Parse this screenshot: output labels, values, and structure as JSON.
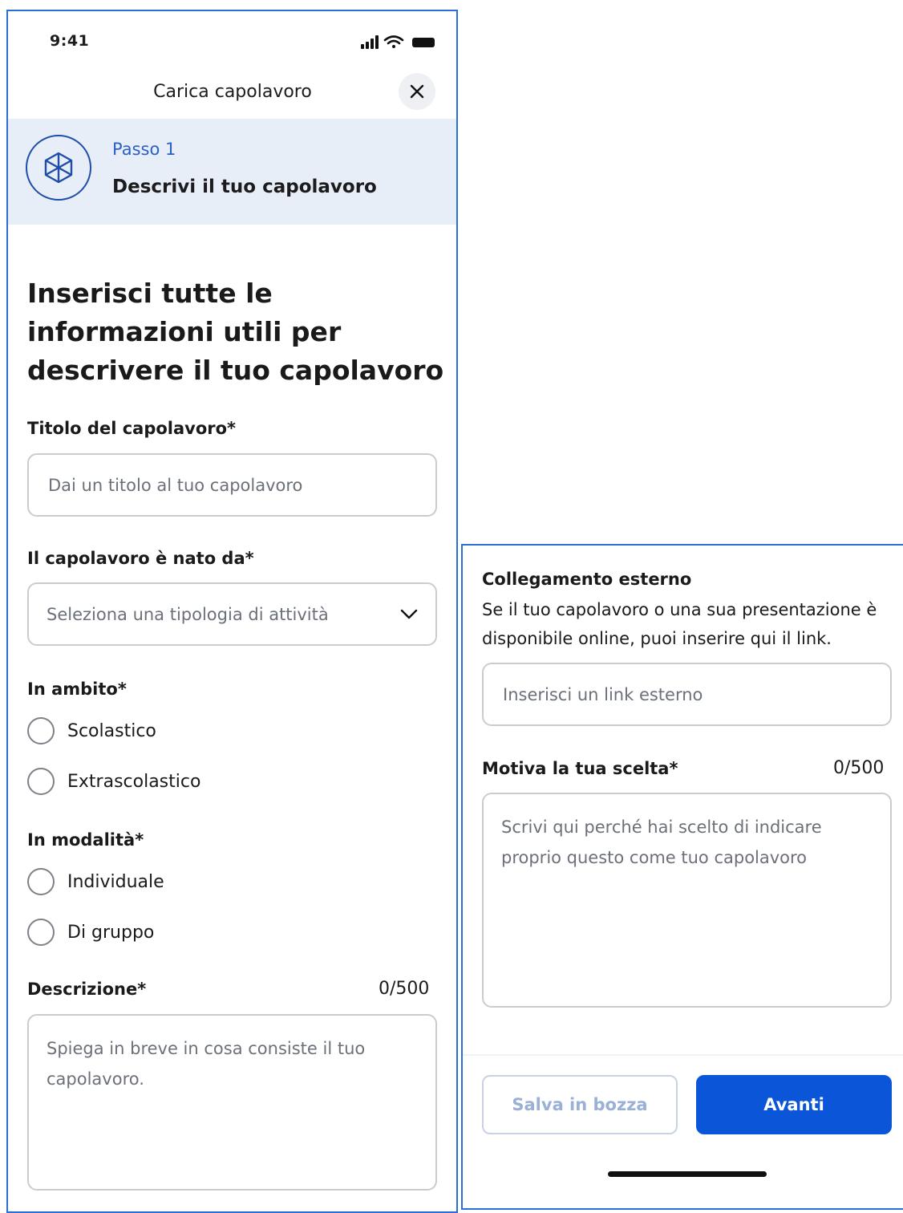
{
  "status_bar": {
    "time": "9:41"
  },
  "header": {
    "title": "Carica capolavoro",
    "close_icon": "close-icon"
  },
  "step": {
    "label": "Passo 1",
    "title": "Descrivi il tuo capolavoro",
    "icon": "cube-icon"
  },
  "form": {
    "heading": "Inserisci tutte le informazioni utili per descrivere il tuo capolavoro",
    "title_field": {
      "label": "Titolo del capolavoro*",
      "placeholder": "Dai un titolo al tuo capolavoro",
      "value": ""
    },
    "origin_field": {
      "label": "Il capolavoro è nato da*",
      "placeholder": "Seleziona una tipologia di attività"
    },
    "scope": {
      "label": "In ambito*",
      "options": [
        "Scolastico",
        "Extrascolastico"
      ]
    },
    "mode": {
      "label": "In modalità*",
      "options": [
        "Individuale",
        "Di gruppo"
      ]
    },
    "description": {
      "label": "Descrizione*",
      "counter": "0/500",
      "placeholder": "Spiega in breve in cosa consiste il tuo capolavoro."
    },
    "external_link": {
      "label": "Collegamento esterno",
      "help": "Se il tuo capolavoro o una sua presentazione è disponibile online, puoi inserire qui il link.",
      "placeholder": "Inserisci un link esterno"
    },
    "motivation": {
      "label": "Motiva la tua scelta*",
      "counter": "0/500",
      "placeholder": "Scrivi qui perché hai scelto di indicare proprio questo come tuo capolavoro"
    }
  },
  "actions": {
    "draft_label": "Salva in bozza",
    "next_label": "Avanti"
  },
  "colors": {
    "accent": "#0b55d9",
    "banner_bg": "#e8eef7",
    "step_label": "#2a5fc7",
    "frame_border": "#2a6fd6"
  }
}
